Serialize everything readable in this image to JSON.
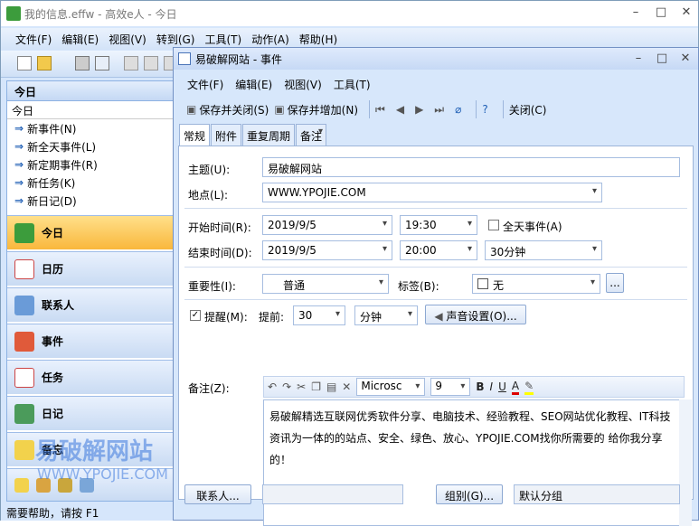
{
  "main": {
    "title": "我的信息.effw - 高效e人 - 今日",
    "min": "–",
    "max": "□",
    "close": "✕",
    "menu": [
      "文件(F)",
      "编辑(E)",
      "视图(V)",
      "转到(G)",
      "工具(T)",
      "动作(A)",
      "帮助(H)"
    ]
  },
  "nav": {
    "header": "今日",
    "sub": "今日",
    "links": [
      "新事件(N)",
      "新全天事件(L)",
      "新定期事件(R)",
      "新任务(K)",
      "新日记(D)"
    ],
    "buttons": [
      "今日",
      "日历",
      "联系人",
      "事件",
      "任务",
      "日记",
      "备忘"
    ]
  },
  "status": "需要帮助，请按 F1",
  "watermark": {
    "cn": "易破解网站",
    "en": "WWW.YPOJIE.COM"
  },
  "dialog": {
    "title": "易破解网站 - 事件",
    "min": "–",
    "max": "□",
    "close": "✕",
    "menu": [
      "文件(F)",
      "编辑(E)",
      "视图(V)",
      "工具(T)"
    ],
    "toolbar": {
      "save_close": "保存并关闭(S)",
      "save_add": "保存并增加(N)",
      "close": "关闭(C)"
    },
    "tabs": [
      "常规",
      "附件",
      "重复周期",
      "备注"
    ],
    "form": {
      "subject_label": "主题(U):",
      "subject": "易破解网站",
      "location_label": "地点(L):",
      "location": "WWW.YPOJIE.COM",
      "start_label": "开始时间(R):",
      "start_date": "2019/9/5",
      "start_time": "19:30",
      "allday_label": "全天事件(A)",
      "end_label": "结束时间(D):",
      "end_date": "2019/9/5",
      "end_time": "20:00",
      "duration": "30分钟",
      "importance_label": "重要性(I):",
      "importance": "普通",
      "tag_label": "标签(B):",
      "tag": "无",
      "ellipsis": "...",
      "reminder_label": "提醒(M):",
      "advance_label": "提前:",
      "advance_value": "30",
      "advance_unit": "分钟",
      "sound_btn": "声音设置(O)...",
      "notes_label": "备注(Z):",
      "font": "Microsc",
      "font_size": "9",
      "notes": "易破解精选互联网优秀软件分享、电脑技术、经验教程、SEO网站优化教程、IT科技资讯为一体的的站点、安全、绿色、放心、YPOJIE.COM找你所需要的 给你我分享的！",
      "contacts_btn": "联系人...",
      "group_btn": "组别(G)...",
      "group_value": "默认分组"
    }
  }
}
